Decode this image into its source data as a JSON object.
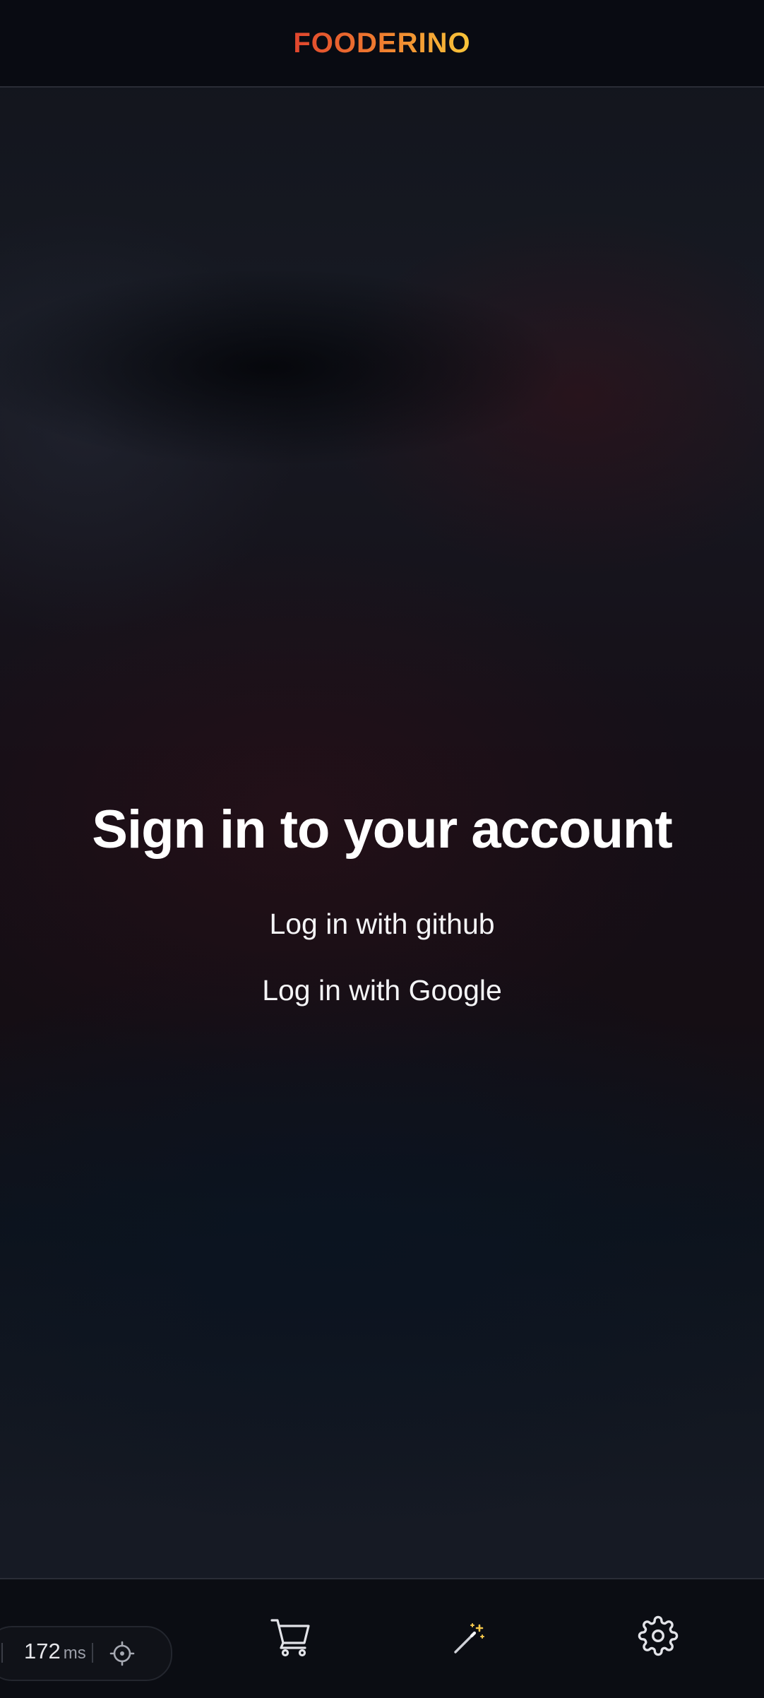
{
  "header": {
    "logo_text": "FOODERINO"
  },
  "main": {
    "title": "Sign in to your account",
    "github_login_label": "Log in with github",
    "google_login_label": "Log in with Google"
  },
  "bottom_nav": {
    "items": [
      {
        "icon": "cart-icon"
      },
      {
        "icon": "magic-wand-icon"
      },
      {
        "icon": "gear-icon"
      }
    ]
  },
  "perf_overlay": {
    "value": "172",
    "unit": "ms",
    "icon": "crosshair-icon"
  },
  "colors": {
    "logo_gradient_start": "#e0452e",
    "logo_gradient_end": "#f8c63a",
    "header_bg": "#090b12",
    "text": "#ffffff"
  }
}
